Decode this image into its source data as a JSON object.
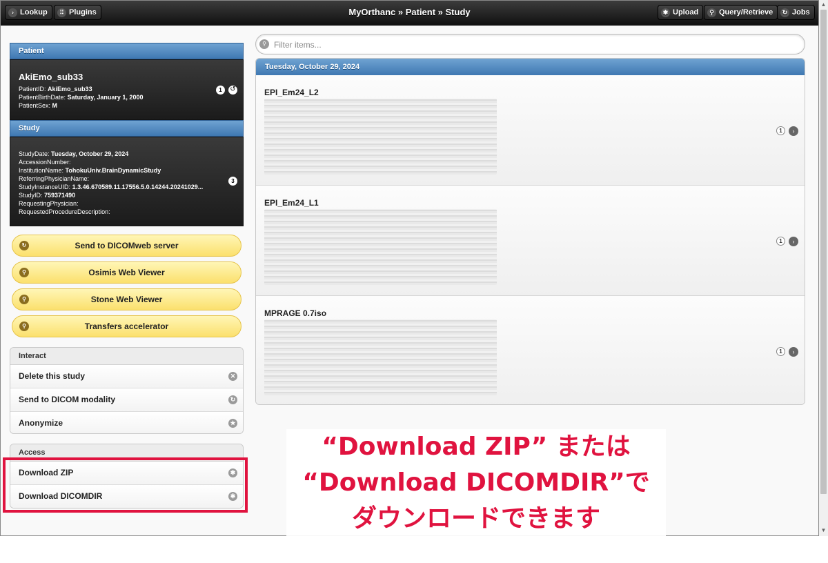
{
  "topbar": {
    "title": "MyOrthanc » Patient » Study",
    "left_buttons": [
      {
        "label": "Lookup",
        "icon": "chevron-right-icon"
      },
      {
        "label": "Plugins",
        "icon": "grid-icon"
      }
    ],
    "right_buttons": [
      {
        "label": "Upload",
        "icon": "gear-icon"
      },
      {
        "label": "Query/Retrieve",
        "icon": "search-icon"
      },
      {
        "label": "Jobs",
        "icon": "refresh-icon"
      }
    ]
  },
  "patient": {
    "header": "Patient",
    "name": "AkiEmo_sub33",
    "fields": [
      {
        "key": "PatientID:",
        "value": "AkiEmo_sub33"
      },
      {
        "key": "PatientBirthDate:",
        "value": "Saturday, January 1, 2000"
      },
      {
        "key": "PatientSex:",
        "value": "M"
      }
    ],
    "count": "1"
  },
  "study": {
    "header": "Study",
    "fields": [
      {
        "key": "StudyDate:",
        "value": "Tuesday, October 29, 2024"
      },
      {
        "key": "AccessionNumber:",
        "value": ""
      },
      {
        "key": "InstitutionName:",
        "value": "TohokuUniv.BrainDynamicStudy"
      },
      {
        "key": "ReferringPhysicianName:",
        "value": ""
      },
      {
        "key": "StudyInstanceUID:",
        "value": "1.3.46.670589.11.17556.5.0.14244.20241029..."
      },
      {
        "key": "StudyID:",
        "value": "759371490"
      },
      {
        "key": "RequestingPhysician:",
        "value": ""
      },
      {
        "key": "RequestedProcedureDescription:",
        "value": ""
      }
    ],
    "count": "3"
  },
  "actions": [
    {
      "label": "Send to DICOMweb server",
      "icon": "refresh-icon"
    },
    {
      "label": "Osimis Web Viewer",
      "icon": "search-icon"
    },
    {
      "label": "Stone Web Viewer",
      "icon": "search-icon"
    },
    {
      "label": "Transfers accelerator",
      "icon": "search-icon"
    }
  ],
  "interact": {
    "header": "Interact",
    "items": [
      {
        "label": "Delete this study",
        "icon": "delete-icon"
      },
      {
        "label": "Send to DICOM modality",
        "icon": "forward-icon"
      },
      {
        "label": "Anonymize",
        "icon": "star-icon"
      }
    ]
  },
  "access": {
    "header": "Access",
    "items": [
      {
        "label": "Download ZIP",
        "icon": "gear-icon"
      },
      {
        "label": "Download DICOMDIR",
        "icon": "gear-icon"
      }
    ]
  },
  "filter": {
    "placeholder": "Filter items..."
  },
  "date_header": "Tuesday, October 29, 2024",
  "series": [
    {
      "name": "EPI_Em24_L2",
      "count": "1"
    },
    {
      "name": "EPI_Em24_L1",
      "count": "1"
    },
    {
      "name": "MPRAGE 0.7iso",
      "count": "1"
    }
  ],
  "callout": {
    "lines": [
      "“Download ZIP” または",
      "“Download DICOMDIR”で",
      "ダウンロードできます"
    ]
  },
  "colors": {
    "highlight": "#e0133f",
    "panel_blue": "#4f87bf",
    "button_yellow": "#fbe06d"
  }
}
